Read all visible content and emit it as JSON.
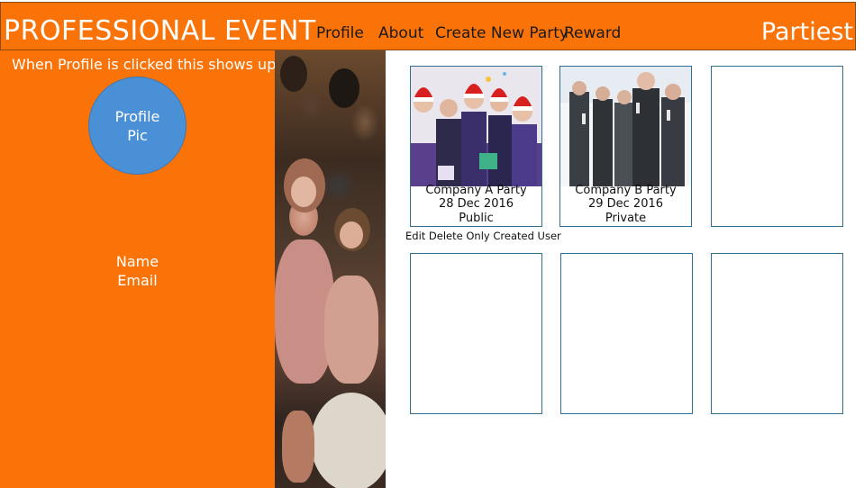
{
  "header": {
    "brand": "PROFESSIONAL EVENT",
    "nav": [
      "Profile",
      "About",
      "Create New Party",
      "Reward"
    ],
    "app_name": "Partiest",
    "color": "#f97308"
  },
  "profile_panel": {
    "note": "When Profile is clicked this shows up",
    "avatar_line1": "Profile",
    "avatar_line2": "Pic",
    "name": "Name",
    "email": "Email"
  },
  "events": [
    {
      "title": "Company A Party",
      "date": "28 Dec 2016",
      "visibility": "Public"
    },
    {
      "title": "Company B Party",
      "date": "29 Dec 2016",
      "visibility": "Private"
    }
  ],
  "card_note": "Edit Delete Only Created User"
}
